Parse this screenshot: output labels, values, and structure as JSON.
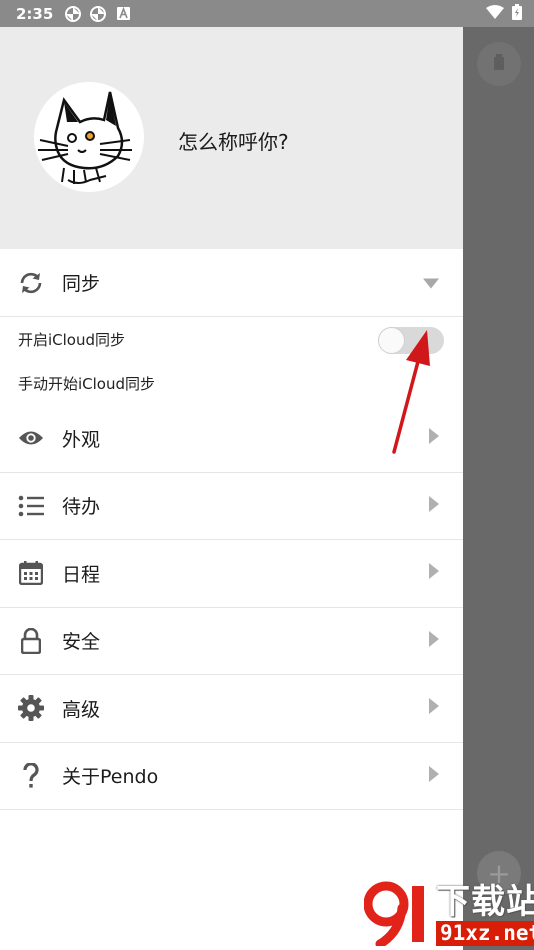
{
  "status_bar": {
    "time": "2:35",
    "left_icons": [
      "pinwheel-icon",
      "pinwheel-icon",
      "font-a-icon"
    ],
    "right_icons": [
      "wifi-icon",
      "battery-icon"
    ]
  },
  "drawer": {
    "user_name": "怎么称呼你?",
    "avatar_icon": "cat-avatar-icon",
    "sync": {
      "label": "同步",
      "icon": "sync-icon",
      "expanded": true,
      "enable_icloud_label": "开启iCloud同步",
      "enable_icloud_on": false,
      "manual_icloud_label": "手动开始iCloud同步"
    },
    "items": [
      {
        "label": "外观",
        "icon": "eye-icon"
      },
      {
        "label": "待办",
        "icon": "list-icon"
      },
      {
        "label": "日程",
        "icon": "calendar-icon"
      },
      {
        "label": "安全",
        "icon": "lock-icon"
      },
      {
        "label": "高级",
        "icon": "gear-icon"
      },
      {
        "label": "关于Pendo",
        "icon": "question-icon"
      }
    ]
  },
  "background": {
    "top_fab_icon": "trash-icon",
    "bottom_fab_icon": "plus-icon",
    "bottom_fab_label": "+"
  },
  "watermark": {
    "title": "下载站",
    "url": "91xz.net"
  },
  "colors": {
    "header_bg": "#ebebeb",
    "scrim": "#696969",
    "annotation_arrow": "#d0181b",
    "watermark_red": "#d81e06"
  }
}
